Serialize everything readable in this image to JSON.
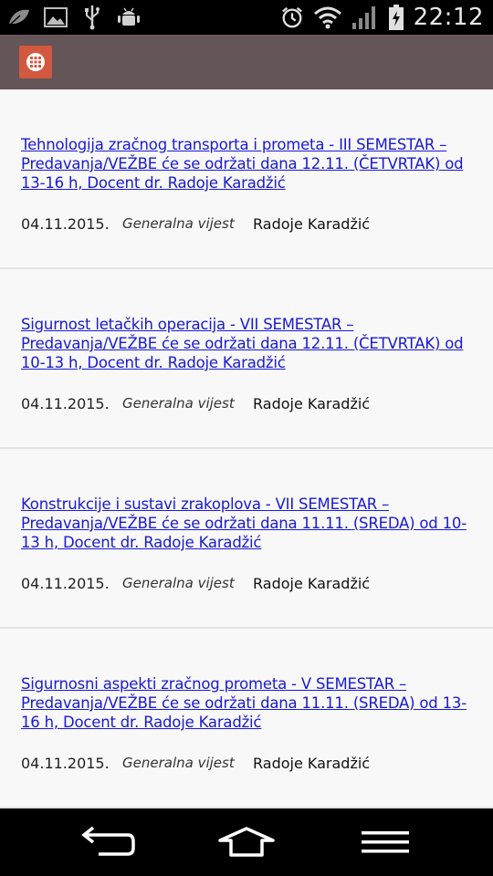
{
  "status_bar": {
    "time": "22:12",
    "icons": [
      "leaf-icon",
      "image-icon",
      "usb-icon",
      "android-debug-icon",
      "alarm-icon",
      "wifi-icon",
      "signal-icon",
      "battery-charging-icon"
    ]
  },
  "app_bar": {
    "menu_icon": "grid-menu-icon",
    "accent_color": "#d2583f",
    "background_color": "#645558"
  },
  "news": [
    {
      "title": "Tehnologija zračnog transporta i prometa - III SEMESTAR – Predavanja/VEŽBE će se održati dana 12.11. (ČETVRTAK) od 13-16 h, Docent dr. Radoje Karadžić",
      "date": "04.11.2015.",
      "category": "Generalna vijest",
      "author": "Radoje Karadžić"
    },
    {
      "title": "Sigurnost letačkih operacija - VII SEMESTAR – Predavanja/VEŽBE će se održati dana 12.11. (ČETVRTAK) od 10-13 h, Docent dr. Radoje Karadžić",
      "date": "04.11.2015.",
      "category": "Generalna vijest",
      "author": "Radoje Karadžić"
    },
    {
      "title": "Konstrukcije i sustavi zrakoplova - VII SEMESTAR – Predavanja/VEŽBE će se održati dana 11.11. (SREDA) od 10-13 h, Docent dr. Radoje Karadžić",
      "date": "04.11.2015.",
      "category": "Generalna vijest",
      "author": "Radoje Karadžić"
    },
    {
      "title": "Sigurnosni aspekti zračnog prometa - V SEMESTAR – Predavanja/VEŽBE će se održati dana 11.11. (SREDA) od 13-16 h, Docent dr. Radoje Karadžić",
      "date": "04.11.2015.",
      "category": "Generalna vijest",
      "author": "Radoje Karadžić"
    }
  ],
  "nav_bar": {
    "icons": [
      "back-icon",
      "home-icon",
      "menu-icon"
    ]
  }
}
